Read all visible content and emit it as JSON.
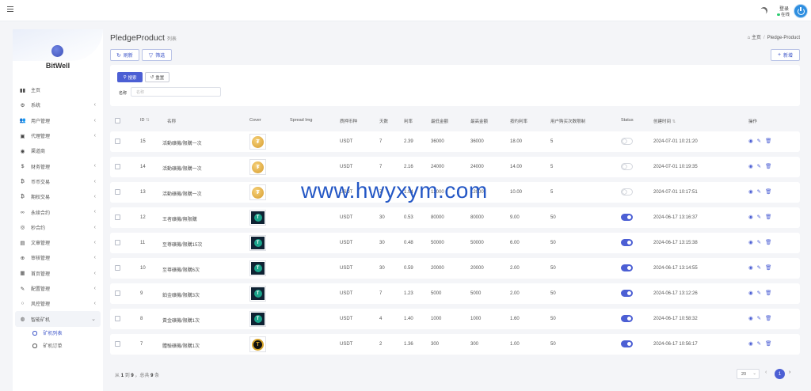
{
  "header": {
    "user_name": "登录",
    "user_status": "在线"
  },
  "sidebar": {
    "logo_text": "BitWell",
    "items": [
      {
        "label": "主页",
        "icon": "chart-icon",
        "glyph": "▮▮",
        "has_children": false
      },
      {
        "label": "系统",
        "icon": "gear-icon",
        "glyph": "⚙",
        "has_children": true
      },
      {
        "label": "用户管理",
        "icon": "users-icon",
        "glyph": "👥",
        "has_children": true
      },
      {
        "label": "代理管理",
        "icon": "id-card-icon",
        "glyph": "▣",
        "has_children": true
      },
      {
        "label": "渠道商",
        "icon": "user-circle-icon",
        "glyph": "◉",
        "has_children": false
      },
      {
        "label": "财务管理",
        "icon": "dollar-icon",
        "glyph": "$",
        "has_children": true
      },
      {
        "label": "币币交易",
        "icon": "bitcoin-icon",
        "glyph": "₿",
        "has_children": true
      },
      {
        "label": "期权交易",
        "icon": "bitcoin-icon",
        "glyph": "₿",
        "has_children": true
      },
      {
        "label": "永续合约",
        "icon": "link-icon",
        "glyph": "∞",
        "has_children": true
      },
      {
        "label": "秒合约",
        "icon": "target-icon",
        "glyph": "◎",
        "has_children": true
      },
      {
        "label": "文章管理",
        "icon": "newspaper-icon",
        "glyph": "▤",
        "has_children": true
      },
      {
        "label": "审核管理",
        "icon": "globe-icon",
        "glyph": "⊕",
        "has_children": true
      },
      {
        "label": "首页管理",
        "icon": "table-icon",
        "glyph": "▦",
        "has_children": true
      },
      {
        "label": "配置管理",
        "icon": "wrench-icon",
        "glyph": "✎",
        "has_children": true
      },
      {
        "label": "风控管理",
        "icon": "circle-icon",
        "glyph": "○",
        "has_children": true
      },
      {
        "label": "智能矿机",
        "icon": "robot-icon",
        "glyph": "◍",
        "has_children": true,
        "open": true
      }
    ],
    "sub_items": [
      {
        "label": "矿机列表",
        "active": true
      },
      {
        "label": "矿机订单",
        "active": false
      }
    ]
  },
  "page": {
    "title": "PledgeProduct",
    "subtitle": "列表",
    "breadcrumb_home": "主页",
    "breadcrumb_current": "Pledge-Product"
  },
  "toolbar": {
    "refresh_label": "刷新",
    "filter_label": "筛选",
    "new_label": "新增"
  },
  "filter": {
    "search_label": "搜索",
    "reset_label": "重置",
    "name_label": "名称",
    "name_placeholder": "名称"
  },
  "table": {
    "columns": [
      "ID",
      "名称",
      "Cover",
      "Spread Img",
      "质押币种",
      "天数",
      "利率",
      "最低金额",
      "最高金额",
      "按约利率",
      "用户购买次数限制",
      "Status",
      "创建时间",
      "操作"
    ],
    "rows": [
      {
        "id": "15",
        "name": "活動礦機/限購一次",
        "cover": "gold",
        "coin": "USDT",
        "days": "7",
        "rate": "2.39",
        "min": "36000",
        "max": "36000",
        "penalty": "18.00",
        "limit": "5",
        "status": false,
        "created": "2024-07-01 10:21:20"
      },
      {
        "id": "14",
        "name": "活動礦機/限購一次",
        "cover": "gold",
        "coin": "USDT",
        "days": "7",
        "rate": "2.16",
        "min": "24000",
        "max": "24000",
        "penalty": "14.00",
        "limit": "5",
        "status": false,
        "created": "2024-07-01 10:19:35"
      },
      {
        "id": "13",
        "name": "活動礦機/限購一次",
        "cover": "gold",
        "coin": "USDT",
        "days": "7",
        "rate": "1.94",
        "min": "12000",
        "max": "12000",
        "penalty": "10.00",
        "limit": "5",
        "status": false,
        "created": "2024-07-01 10:17:51"
      },
      {
        "id": "12",
        "name": "王者礦機/無限購",
        "cover": "tether",
        "coin": "USDT",
        "days": "30",
        "rate": "0.53",
        "min": "80000",
        "max": "80000",
        "penalty": "9.00",
        "limit": "50",
        "status": true,
        "created": "2024-06-17 13:16:37"
      },
      {
        "id": "11",
        "name": "至尊礦機/限購15次",
        "cover": "tether",
        "coin": "USDT",
        "days": "30",
        "rate": "0.48",
        "min": "50000",
        "max": "50000",
        "penalty": "6.00",
        "limit": "50",
        "status": true,
        "created": "2024-06-17 13:15:38"
      },
      {
        "id": "10",
        "name": "至尊礦機/限購6次",
        "cover": "tether",
        "coin": "USDT",
        "days": "30",
        "rate": "0.59",
        "min": "20000",
        "max": "20000",
        "penalty": "2.00",
        "limit": "50",
        "status": true,
        "created": "2024-06-17 13:14:55"
      },
      {
        "id": "9",
        "name": "鉑金礦機/限購3次",
        "cover": "tether",
        "coin": "USDT",
        "days": "7",
        "rate": "1.23",
        "min": "5000",
        "max": "5000",
        "penalty": "2.00",
        "limit": "50",
        "status": true,
        "created": "2024-06-17 13:12:26"
      },
      {
        "id": "8",
        "name": "黃金礦機/限購1次",
        "cover": "tether",
        "coin": "USDT",
        "days": "4",
        "rate": "1.40",
        "min": "1000",
        "max": "1000",
        "penalty": "1.60",
        "limit": "50",
        "status": true,
        "created": "2024-06-17 10:58:32"
      },
      {
        "id": "7",
        "name": "體驗礦機/限購1次",
        "cover": "tgold",
        "coin": "USDT",
        "days": "2",
        "rate": "1.36",
        "min": "300",
        "max": "300",
        "penalty": "1.00",
        "limit": "50",
        "status": true,
        "created": "2024-06-17 10:56:17"
      }
    ]
  },
  "footer": {
    "summary_prefix": "从",
    "summary_from": "1",
    "summary_to_word": "到",
    "summary_to": "9",
    "summary_total_word": "，总共",
    "summary_total": "9",
    "summary_suffix": "条",
    "page_size": "20",
    "current_page": "1"
  },
  "watermark": "www.hwyxym.com",
  "colors": {
    "accent": "#4c5fd4",
    "background": "#f4f5f8",
    "online": "#2ecc71"
  }
}
